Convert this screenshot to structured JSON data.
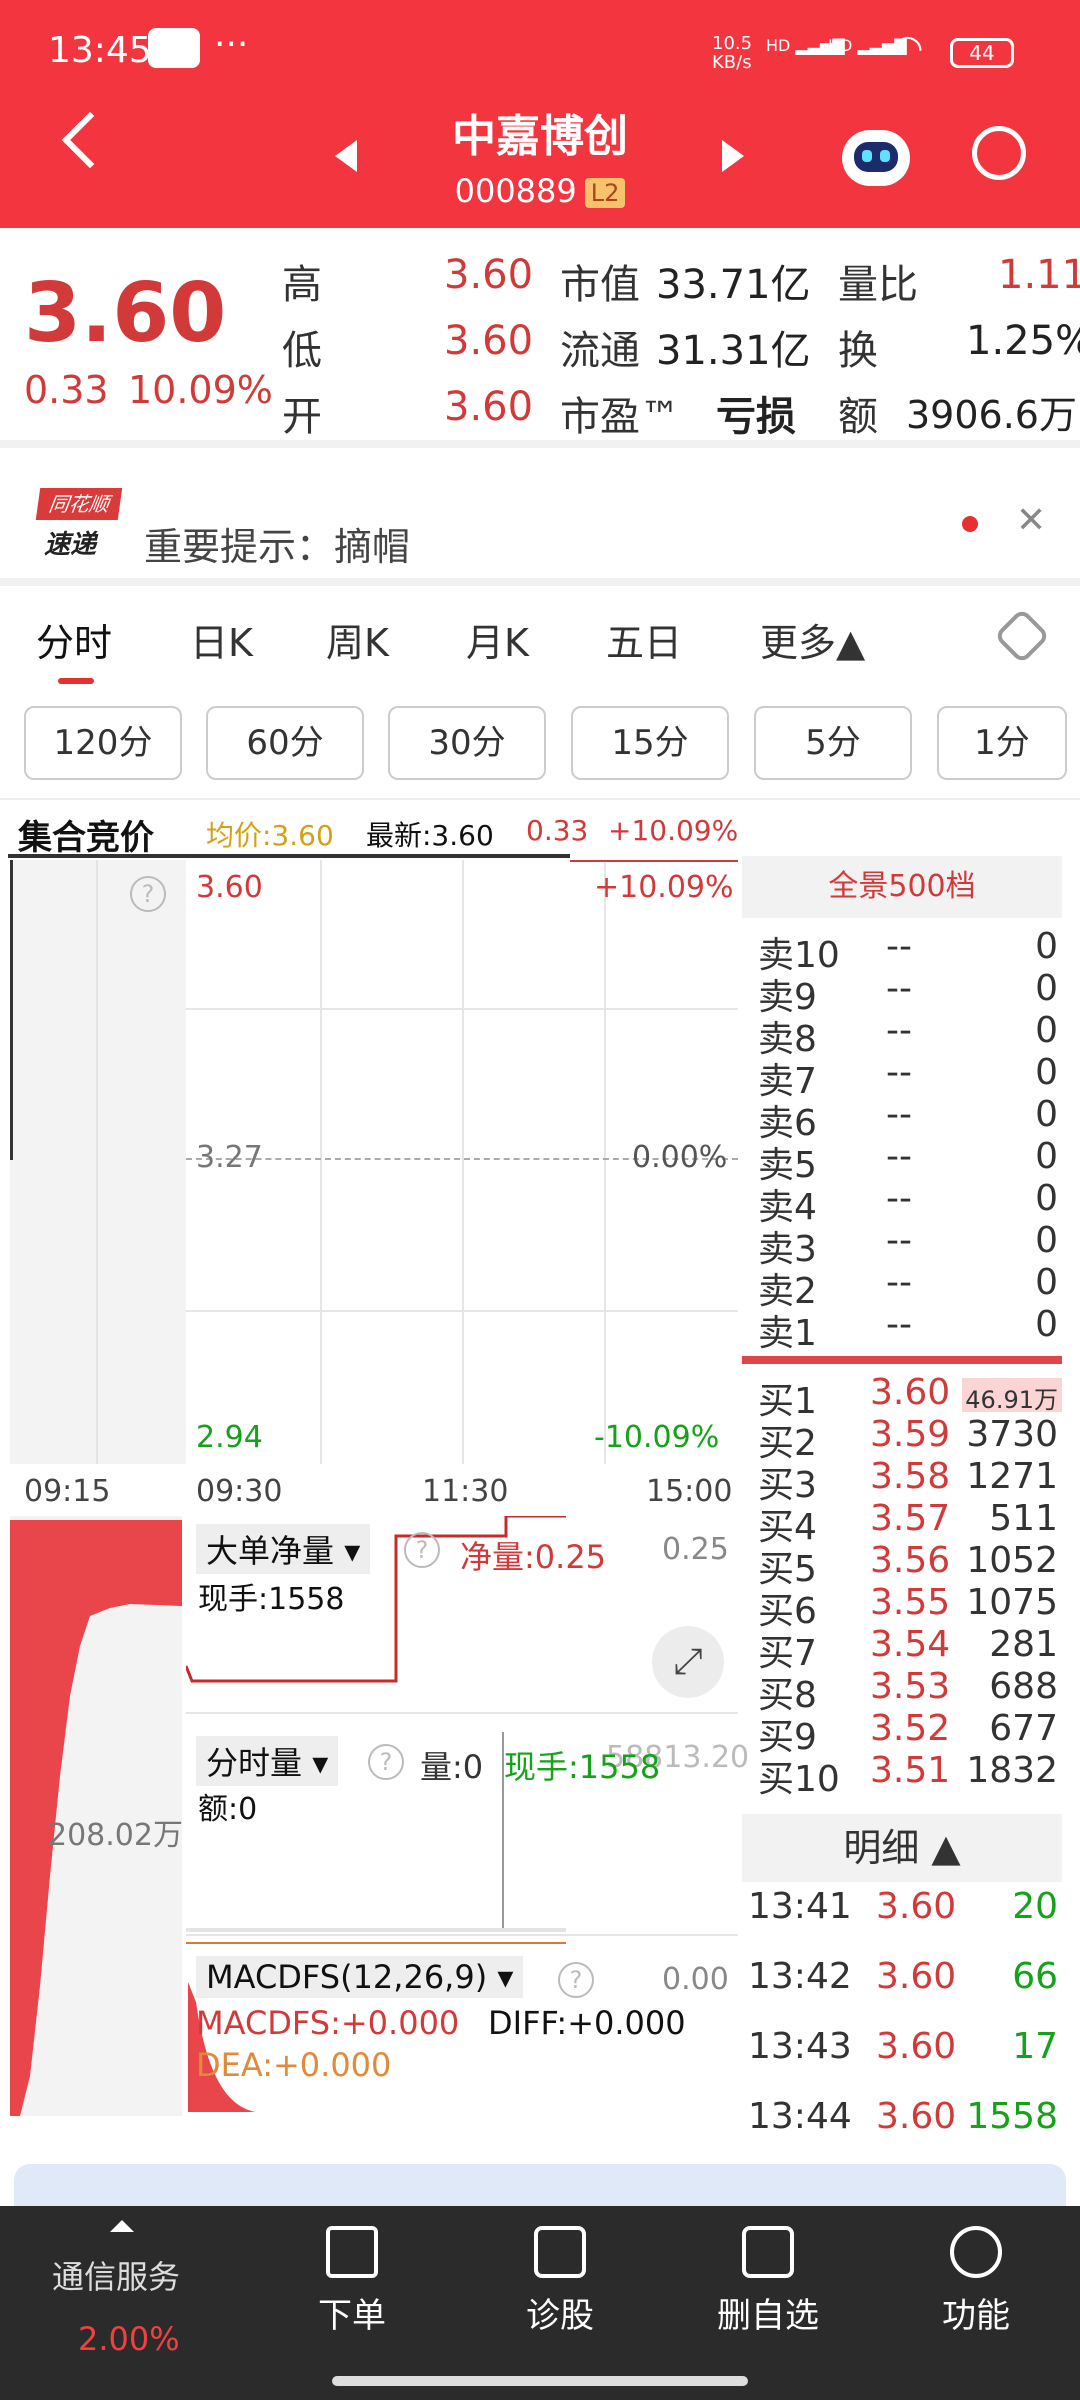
{
  "status_bar": {
    "time": "13:45",
    "dots": "···",
    "net_speed_top": "10.5",
    "net_speed_bottom": "KB/s",
    "signal1": "HD",
    "signal2": "HD",
    "battery": "44"
  },
  "header": {
    "title": "中嘉博创",
    "code": "000889",
    "level_badge": "L2"
  },
  "quote": {
    "price": "3.60",
    "change": "0.33",
    "change_pct": "10.09%",
    "high_label": "高",
    "high": "3.60",
    "low_label": "低",
    "low": "3.60",
    "open_label": "开",
    "open": "3.60",
    "mcap_label": "市值",
    "mcap": "33.71亿",
    "float_label": "流通",
    "float": "31.31亿",
    "pe_label": "市盈™",
    "pe": "亏损",
    "vr_label": "量比",
    "vr": "1.11",
    "turn_label": "换",
    "turn": "1.25%",
    "amt_label": "额",
    "amt": "3906.6万"
  },
  "notice": {
    "logo_top": "同花顺",
    "logo_bottom": "速递",
    "text": "重要提示：摘帽"
  },
  "tabs": [
    "分时",
    "日K",
    "周K",
    "月K",
    "五日",
    "更多▲"
  ],
  "ranges": [
    "120分",
    "60分",
    "30分",
    "15分",
    "5分",
    "1分"
  ],
  "chart": {
    "auction_label": "集合竞价",
    "avg": "均价:3.60",
    "latest": "最新:3.60",
    "chg": "0.33",
    "chg_pct": "+10.09%",
    "y_top": "3.60",
    "y_mid": "3.27",
    "y_bot": "2.94",
    "pct_top": "+10.09%",
    "pct_mid": "0.00%",
    "pct_bot": "-10.09%",
    "t0": "09:15",
    "t1": "09:30",
    "t2": "11:30",
    "t3": "15:00",
    "left_volume": "208.02万",
    "big_order_label": "大单净量",
    "big_order_hand": "现手:1558",
    "big_order_net": "净量:0.25",
    "big_order_max": "0.25",
    "vol_label": "分时量",
    "vol_qty": "量:0",
    "vol_hand": "现手:1558",
    "vol_amt": "额:0",
    "vol_max": "58813.20",
    "macd_label": "MACDFS(12,26,9)",
    "macd_val": "MACDFS:+0.000",
    "diff": "DIFF:+0.000",
    "dea": "DEA:+0.000",
    "macd_max": "0.00"
  },
  "orderbook": {
    "title": "全景500档",
    "asks": [
      {
        "label": "卖10",
        "price": "--",
        "vol": "0"
      },
      {
        "label": "卖9",
        "price": "--",
        "vol": "0"
      },
      {
        "label": "卖8",
        "price": "--",
        "vol": "0"
      },
      {
        "label": "卖7",
        "price": "--",
        "vol": "0"
      },
      {
        "label": "卖6",
        "price": "--",
        "vol": "0"
      },
      {
        "label": "卖5",
        "price": "--",
        "vol": "0"
      },
      {
        "label": "卖4",
        "price": "--",
        "vol": "0"
      },
      {
        "label": "卖3",
        "price": "--",
        "vol": "0"
      },
      {
        "label": "卖2",
        "price": "--",
        "vol": "0"
      },
      {
        "label": "卖1",
        "price": "--",
        "vol": "0"
      }
    ],
    "bids": [
      {
        "label": "买1",
        "price": "3.60",
        "vol": "46.91万"
      },
      {
        "label": "买2",
        "price": "3.59",
        "vol": "3730"
      },
      {
        "label": "买3",
        "price": "3.58",
        "vol": "1271"
      },
      {
        "label": "买4",
        "price": "3.57",
        "vol": "511"
      },
      {
        "label": "买5",
        "price": "3.56",
        "vol": "1052"
      },
      {
        "label": "买6",
        "price": "3.55",
        "vol": "1075"
      },
      {
        "label": "买7",
        "price": "3.54",
        "vol": "281"
      },
      {
        "label": "买8",
        "price": "3.53",
        "vol": "688"
      },
      {
        "label": "买9",
        "price": "3.52",
        "vol": "677"
      },
      {
        "label": "买10",
        "price": "3.51",
        "vol": "1832"
      }
    ],
    "detail_label": "明细 ▲",
    "trades": [
      {
        "time": "13:41",
        "price": "3.60",
        "vol": "20"
      },
      {
        "time": "13:42",
        "price": "3.60",
        "vol": "66"
      },
      {
        "time": "13:43",
        "price": "3.60",
        "vol": "17"
      },
      {
        "time": "13:44",
        "price": "3.60",
        "vol": "1558"
      }
    ]
  },
  "bottom": {
    "sector": "通信服务",
    "sector_pct": "2.00%",
    "items": [
      "下单",
      "诊股",
      "删自选",
      "功能"
    ]
  },
  "colors": {
    "header": "#f2353e",
    "up": "#d23a3a",
    "down": "#15a21a",
    "nav": "#2b2b2b"
  }
}
